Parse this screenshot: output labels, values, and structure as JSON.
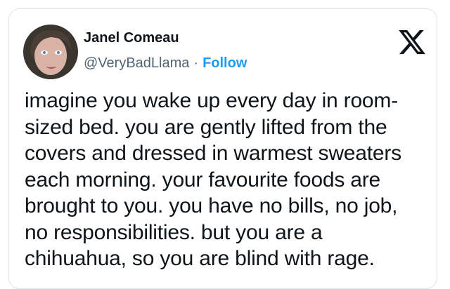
{
  "author": {
    "name": "Janel Comeau",
    "handle": "@VeryBadLlama",
    "separator": "·",
    "follow_label": "Follow"
  },
  "brand": {
    "icon": "x-logo-icon",
    "color": "#0f1419"
  },
  "colors": {
    "text": "#0f1419",
    "secondary": "#536471",
    "accent": "#1d9bf0"
  },
  "tweet": {
    "lines": [
      "imagine you wake up every day in room-",
      "sized bed. you are gently lifted from the",
      "covers and dressed in warmest sweaters",
      "each morning. your favourite foods are",
      "brought to you. you have no bills, no job,",
      "no responsibilities. but you are a",
      "chihuahua, so you are blind with rage."
    ]
  }
}
